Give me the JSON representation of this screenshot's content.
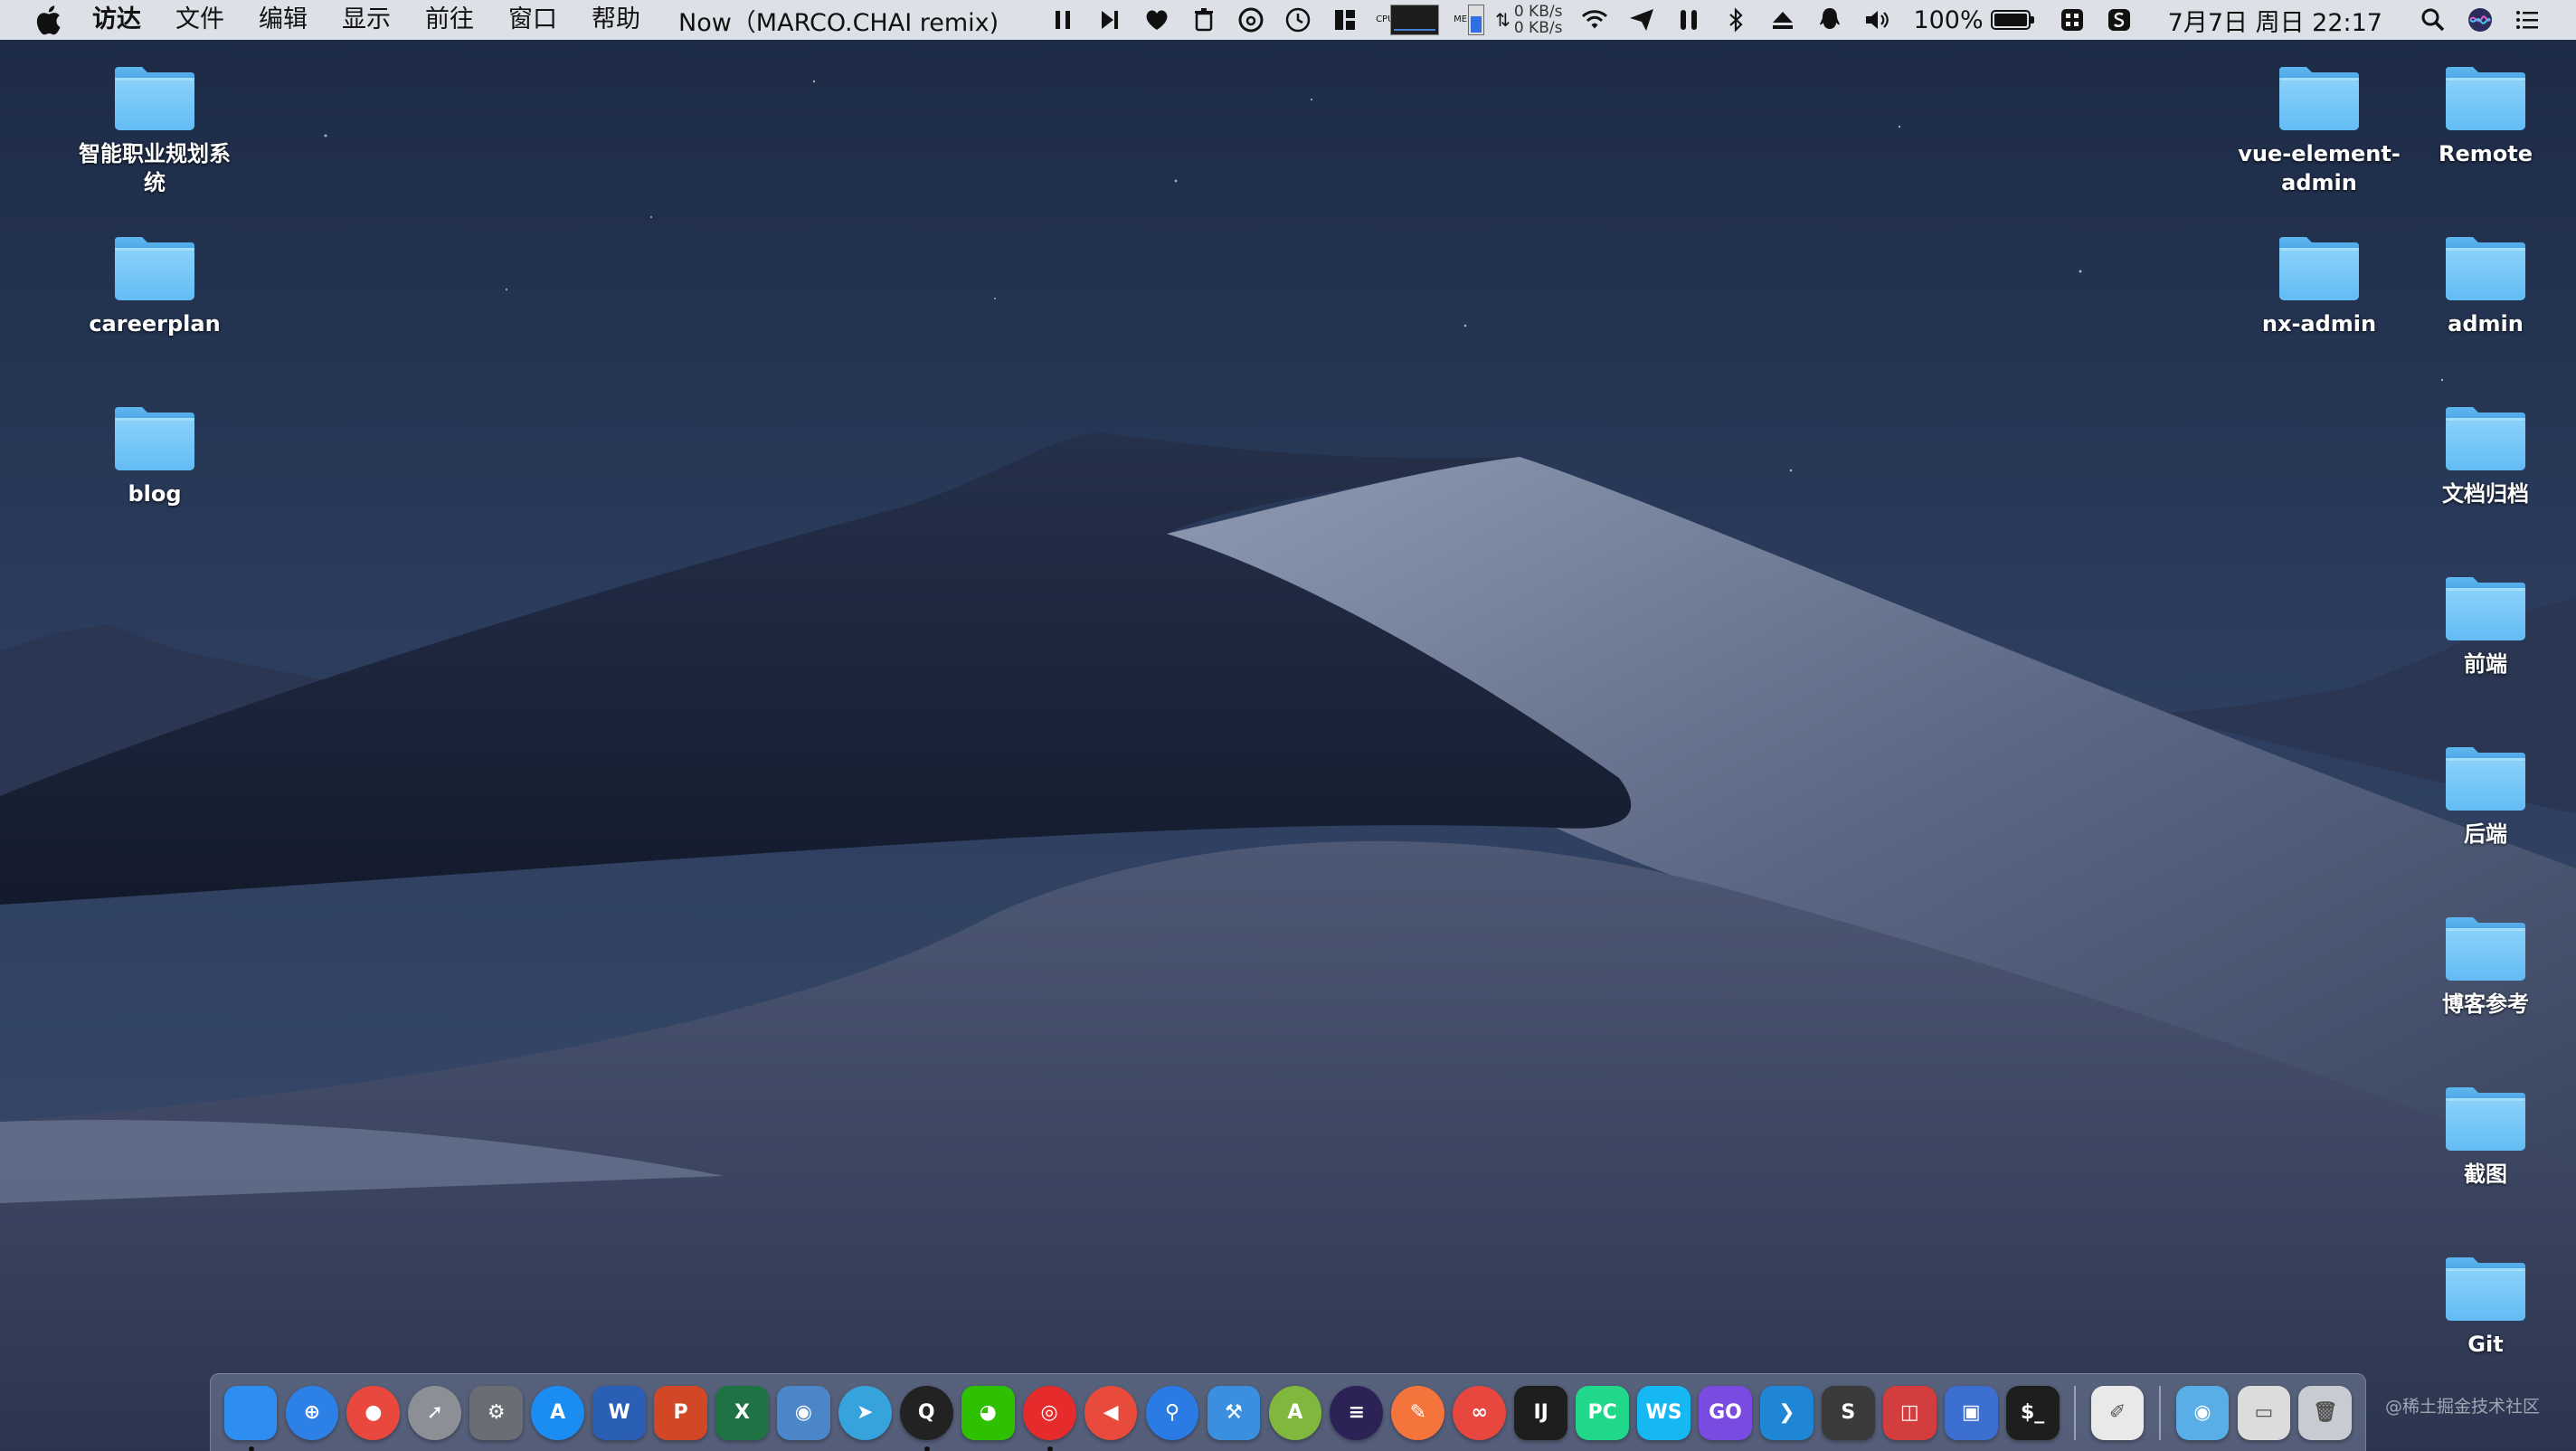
{
  "menubar": {
    "app_name": "访达",
    "menus": [
      "文件",
      "编辑",
      "显示",
      "前往",
      "窗口",
      "帮助"
    ],
    "now_playing": "Now（MARCO.CHAI remix)",
    "cpu_label": "CPU",
    "mem_label": "MEM",
    "net_up": "0 KB/s",
    "net_down": "0 KB/s",
    "battery_pct": "100%",
    "battery_level": 1.0,
    "clock": "7月7日 周日  22:17",
    "tray_icons": [
      "pause-icon",
      "next-track-icon",
      "heart-icon",
      "trash-icon",
      "netease-music-icon",
      "clock-icon",
      "layout-icon",
      "wifi-icon",
      "send-icon",
      "airpods-icon",
      "bluetooth-icon",
      "eject-icon",
      "qq-icon",
      "volume-icon",
      "grid-icon",
      "sync-icon",
      "search-icon",
      "siri-icon",
      "list-icon"
    ]
  },
  "desktop": {
    "left_column": [
      {
        "label": "智能职业规划系统"
      },
      {
        "label": "careerplan"
      },
      {
        "label": "blog"
      }
    ],
    "second_right_column": [
      {
        "label": "vue-element-admin"
      },
      {
        "label": "nx-admin"
      }
    ],
    "right_column": [
      {
        "label": "Remote"
      },
      {
        "label": "admin"
      },
      {
        "label": "文档归档"
      },
      {
        "label": "前端"
      },
      {
        "label": "后端"
      },
      {
        "label": "博客参考"
      },
      {
        "label": "截图"
      },
      {
        "label": "Git"
      }
    ]
  },
  "dock": {
    "apps": [
      {
        "name": "finder",
        "glyph": "",
        "color": "#2e8df0",
        "running": true
      },
      {
        "name": "safari",
        "glyph": "⊕",
        "color": "#2c80e6",
        "running": false,
        "round": true
      },
      {
        "name": "chrome",
        "glyph": "●",
        "color": "#e9483f",
        "running": false,
        "round": true
      },
      {
        "name": "launchpad",
        "glyph": "➚",
        "color": "#8c8f96",
        "running": false,
        "round": true
      },
      {
        "name": "system-preferences",
        "glyph": "⚙",
        "color": "#6a6d74",
        "running": false
      },
      {
        "name": "app-store",
        "glyph": "A",
        "color": "#1b8cf2",
        "running": false,
        "round": true
      },
      {
        "name": "word",
        "glyph": "W",
        "color": "#2b5fb5",
        "running": false
      },
      {
        "name": "powerpoint",
        "glyph": "P",
        "color": "#d24726",
        "running": false
      },
      {
        "name": "excel",
        "glyph": "X",
        "color": "#1f7244",
        "running": false
      },
      {
        "name": "network-utility",
        "glyph": "◉",
        "color": "#4a86c8",
        "running": false
      },
      {
        "name": "telegram",
        "glyph": "➤",
        "color": "#36a3dd",
        "running": false,
        "round": true
      },
      {
        "name": "qq",
        "glyph": "Q",
        "color": "#222222",
        "running": true,
        "round": true
      },
      {
        "name": "wechat",
        "glyph": "◕",
        "color": "#2dc100",
        "running": false
      },
      {
        "name": "netease-music",
        "glyph": "◎",
        "color": "#e52b2b",
        "running": true,
        "round": true
      },
      {
        "name": "paw",
        "glyph": "◀",
        "color": "#e84a3c",
        "running": false,
        "round": true
      },
      {
        "name": "maps",
        "glyph": "⚲",
        "color": "#2a7be4",
        "running": false,
        "round": true
      },
      {
        "name": "xcode",
        "glyph": "⚒",
        "color": "#3b8fe0",
        "running": false
      },
      {
        "name": "android-studio",
        "glyph": "A",
        "color": "#7fb83c",
        "running": false,
        "round": true
      },
      {
        "name": "eclipse",
        "glyph": "≡",
        "color": "#2c2255",
        "running": false,
        "round": true
      },
      {
        "name": "postman",
        "glyph": "✎",
        "color": "#f4743c",
        "running": false,
        "round": true
      },
      {
        "name": "creative-cloud",
        "glyph": "∞",
        "color": "#e8473f",
        "running": false,
        "round": true
      },
      {
        "name": "intellij-idea",
        "glyph": "IJ",
        "color": "#1e1e1e",
        "running": false
      },
      {
        "name": "pycharm",
        "glyph": "PC",
        "color": "#21d789",
        "running": false
      },
      {
        "name": "webstorm",
        "glyph": "WS",
        "color": "#16b8f3",
        "running": false
      },
      {
        "name": "goland",
        "glyph": "GO",
        "color": "#7a4be0",
        "running": false
      },
      {
        "name": "vscode",
        "glyph": "❯",
        "color": "#1f86d6",
        "running": false
      },
      {
        "name": "sublime-text",
        "glyph": "S",
        "color": "#3a3a3a",
        "running": false
      },
      {
        "name": "vmware-fusion",
        "glyph": "◫",
        "color": "#d43d3d",
        "running": false
      },
      {
        "name": "parallels",
        "glyph": "▣",
        "color": "#3d6fd1",
        "running": false
      },
      {
        "name": "terminal",
        "glyph": "$_",
        "color": "#1e1e1e",
        "running": false
      },
      {
        "name": "textedit",
        "glyph": "✐",
        "color": "#e9e9e9",
        "running": false
      },
      {
        "name": "downloads-folder",
        "glyph": "◉",
        "color": "#5aaee8",
        "running": false
      },
      {
        "name": "screenshot-stack",
        "glyph": "▭",
        "color": "#dcdcdc",
        "running": false
      },
      {
        "name": "trash",
        "glyph": "🗑",
        "color": "#c8ccd2",
        "running": false
      }
    ]
  },
  "watermark": "@稀土掘金技术社区"
}
